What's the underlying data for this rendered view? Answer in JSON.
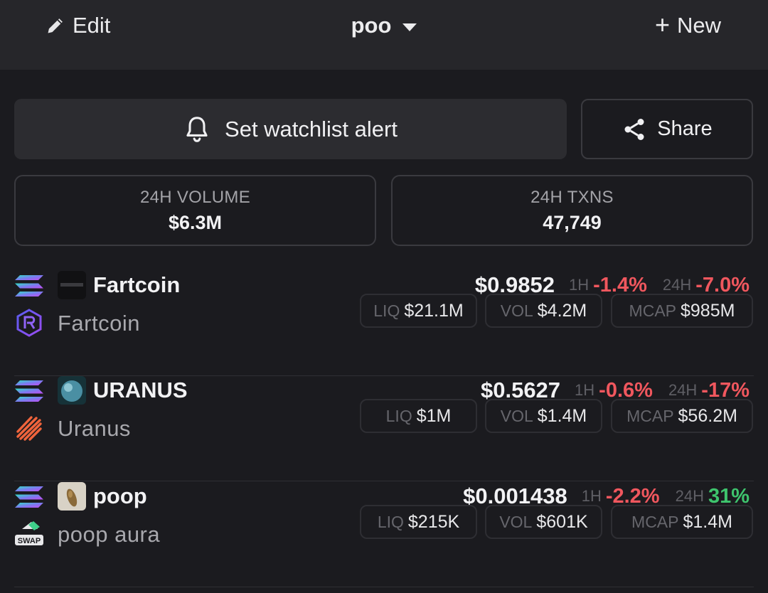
{
  "header": {
    "edit_label": "Edit",
    "title": "poo",
    "new_label": "New"
  },
  "actions": {
    "alert_label": "Set watchlist alert",
    "share_label": "Share"
  },
  "stats": {
    "volume_label": "24H VOLUME",
    "volume_value": "$6.3M",
    "txns_label": "24H TXNS",
    "txns_value": "47,749"
  },
  "tokens": [
    {
      "symbol": "Fartcoin",
      "name": "Fartcoin",
      "price": "$0.9852",
      "h1_label": "1H",
      "h1_change": "-1.4%",
      "h24_label": "24H",
      "h24_change": "-7.0%",
      "liq_label": "LIQ",
      "liq": "$21.1M",
      "vol_label": "VOL",
      "vol": "$4.2M",
      "mcap_label": "MCAP",
      "mcap": "$985M",
      "chain_icon": "solana-icon",
      "dex_icon": "raydium-icon"
    },
    {
      "symbol": "URANUS",
      "name": "Uranus",
      "price": "$0.5627",
      "h1_label": "1H",
      "h1_change": "-0.6%",
      "h24_label": "24H",
      "h24_change": "-17%",
      "liq_label": "LIQ",
      "liq": "$1M",
      "vol_label": "VOL",
      "vol": "$1.4M",
      "mcap_label": "MCAP",
      "mcap": "$56.2M",
      "chain_icon": "solana-icon",
      "dex_icon": "meteora-icon"
    },
    {
      "symbol": "poop",
      "name": "poop aura",
      "price": "$0.001438",
      "h1_label": "1H",
      "h1_change": "-2.2%",
      "h24_label": "24H",
      "h24_change": "31%",
      "liq_label": "LIQ",
      "liq": "$215K",
      "vol_label": "VOL",
      "vol": "$601K",
      "mcap_label": "MCAP",
      "mcap": "$1.4M",
      "chain_icon": "solana-icon",
      "dex_icon": "swap-icon",
      "dex_icon_text": "SWAP"
    }
  ],
  "colors": {
    "negative": "#f0575e",
    "positive": "#3ec46d",
    "background": "#1b1b1f"
  }
}
